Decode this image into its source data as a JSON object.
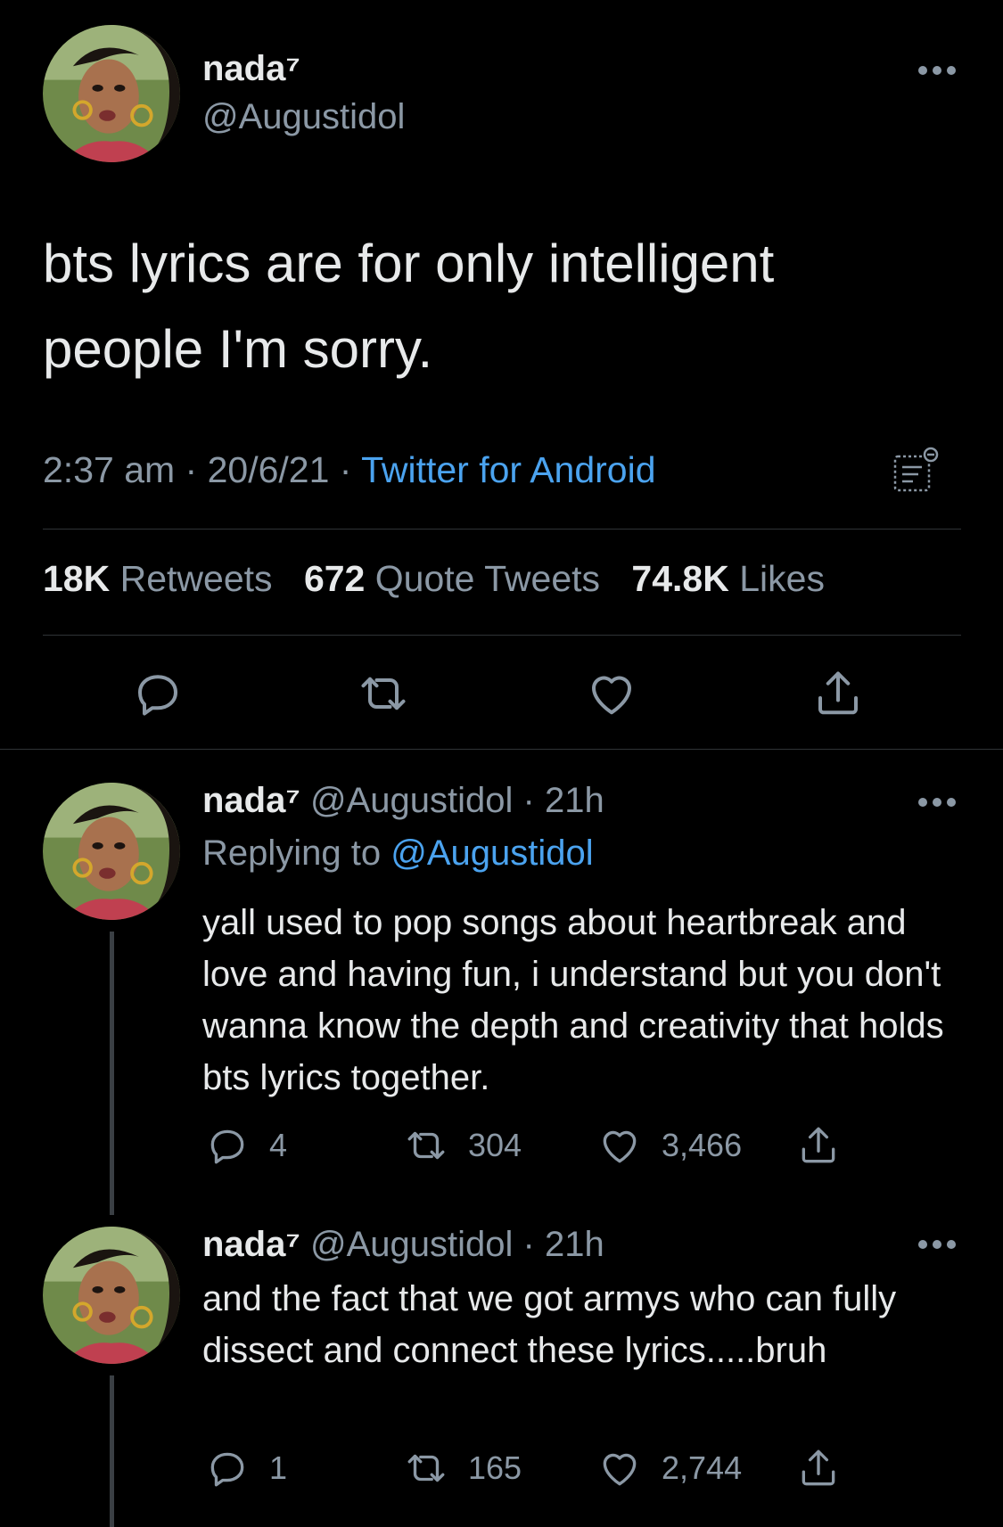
{
  "main_tweet": {
    "display_name": "nada⁷",
    "handle": "@Augustidol",
    "text": "bts lyrics are for only intelligent people I'm sorry.",
    "time": "2:37 am",
    "date": "20/6/21",
    "source": "Twitter for Android",
    "separator": " · ",
    "stats": {
      "retweets_count": "18K",
      "retweets_label": "Retweets",
      "quotes_count": "672",
      "quotes_label": "Quote Tweets",
      "likes_count": "74.8K",
      "likes_label": "Likes"
    },
    "icons": [
      "reply-icon",
      "retweet-icon",
      "like-icon",
      "share-icon",
      "analytics-icon",
      "more-icon"
    ]
  },
  "replies": [
    {
      "display_name": "nada⁷",
      "handle": "@Augustidol",
      "time_ago": "21h",
      "replying_label": "Replying to",
      "replying_to": "@Augustidol",
      "text": "yall used to pop songs about heartbreak and love and having fun, i understand but you don't wanna know the depth and creativity that holds bts lyrics together.",
      "reply_count": "4",
      "retweet_count": "304",
      "like_count": "3,466"
    },
    {
      "display_name": "nada⁷",
      "handle": "@Augustidol",
      "time_ago": "21h",
      "text": "and the fact that we got armys who can fully dissect and connect these lyrics.....bruh",
      "reply_count": "1",
      "retweet_count": "165",
      "like_count": "2,744"
    }
  ],
  "colors": {
    "background": "#000000",
    "text": "#e7e9ea",
    "secondary": "#8b98a5",
    "link": "#4ba3ef",
    "divider": "#2f3336"
  }
}
